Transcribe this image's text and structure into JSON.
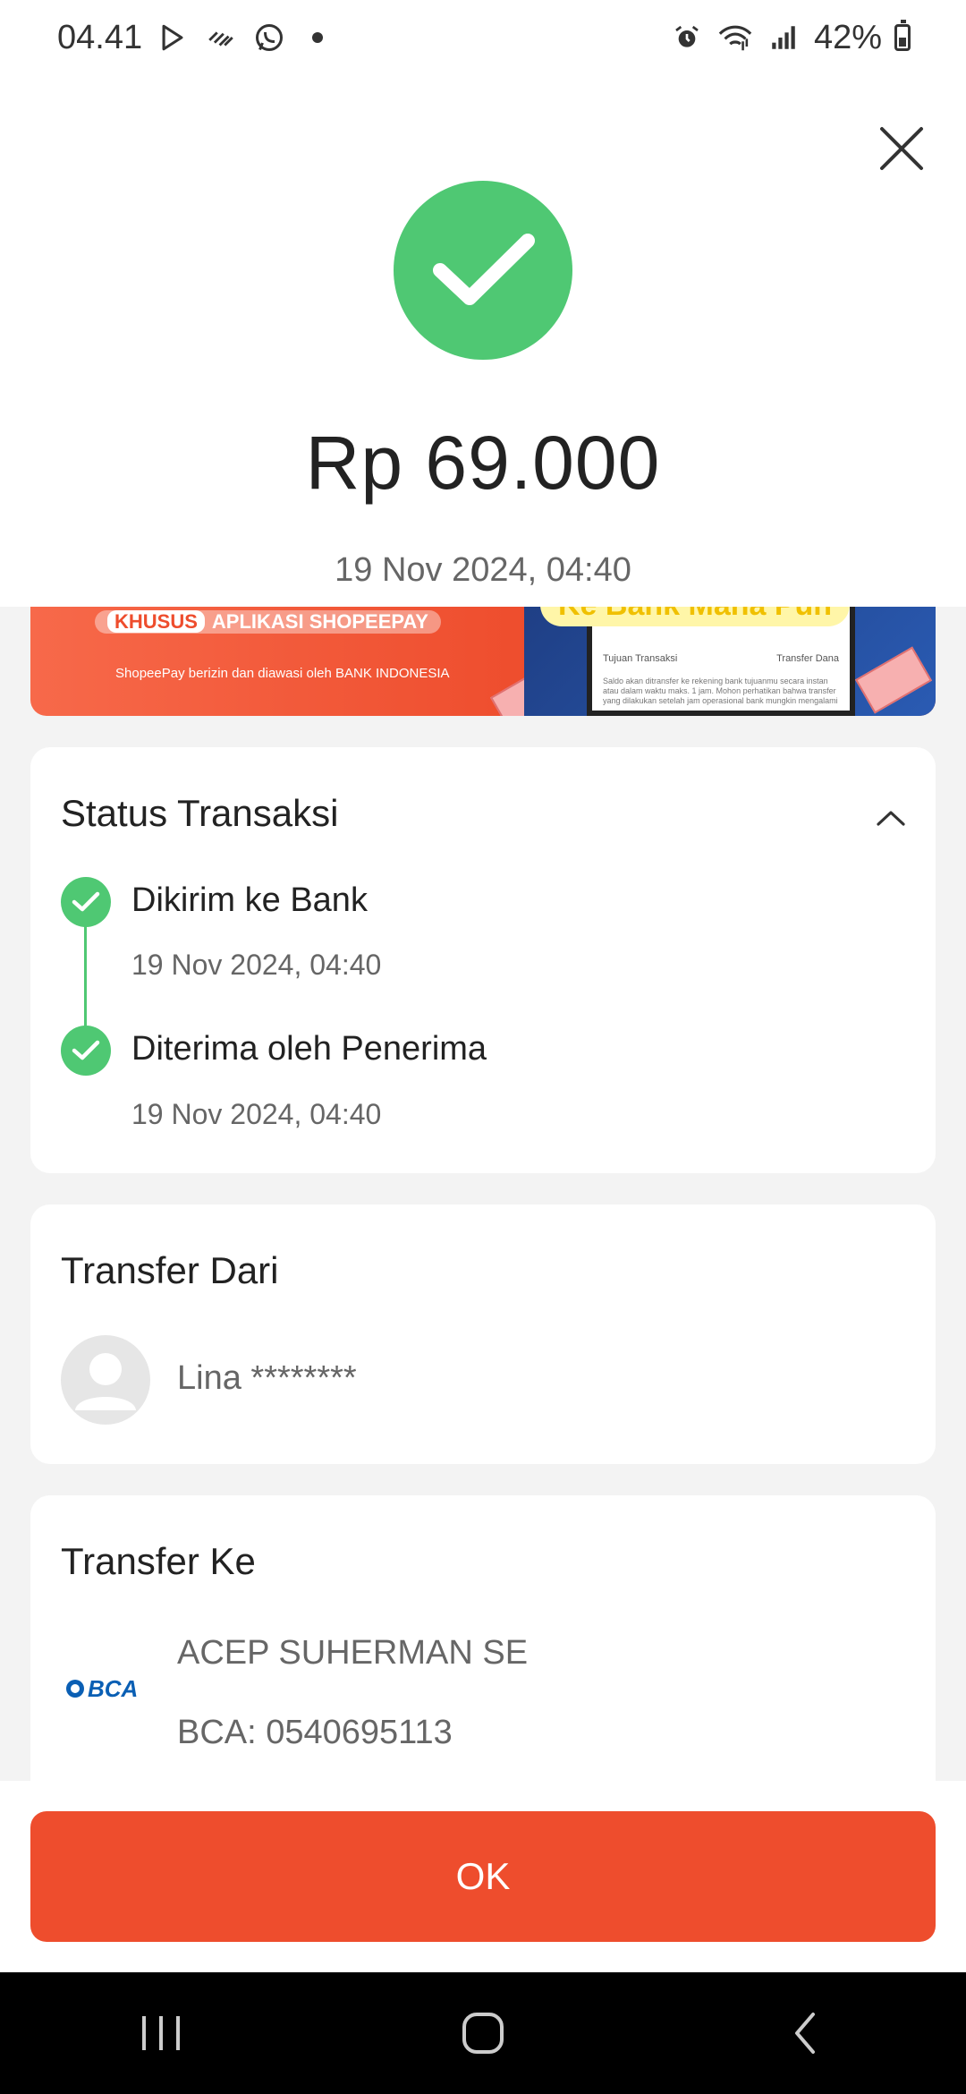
{
  "status_bar": {
    "time": "04.41",
    "battery": "42%",
    "battery_level": 0.42
  },
  "transaction": {
    "amount": "Rp 69.000",
    "date": "19 Nov 2024, 04:40"
  },
  "banner": {
    "pill_label": "KHUSUS",
    "pill_text": "APLIKASI SHOPEEPAY",
    "headline": "Ke Bank Mana Pun",
    "subtext": "ShopeePay berizin dan diawasi oleh BANK INDONESIA",
    "screen_label_left": "Tujuan Transaksi",
    "screen_label_right": "Transfer Dana",
    "screen_note": "Saldo akan ditransfer ke rekening bank tujuanmu secara instan atau dalam waktu maks. 1 jam. Mohon perhatikan bahwa transfer yang dilakukan setelah jam operasional bank mungkin mengalami"
  },
  "status_section": {
    "title": "Status Transaksi",
    "steps": [
      {
        "label": "Dikirim ke Bank",
        "time": "19 Nov 2024, 04:40"
      },
      {
        "label": "Diterima oleh Penerima",
        "time": "19 Nov 2024, 04:40"
      }
    ]
  },
  "from_section": {
    "title": "Transfer Dari",
    "name": "Lina ********"
  },
  "to_section": {
    "title": "Transfer Ke",
    "bank_logo_text": "BCA",
    "name": "ACEP SUHERMAN SE",
    "account": "BCA: 0540695113"
  },
  "ok_button": {
    "label": "OK"
  },
  "colors": {
    "primary": "#ee4d2d",
    "success": "#4fc873"
  }
}
